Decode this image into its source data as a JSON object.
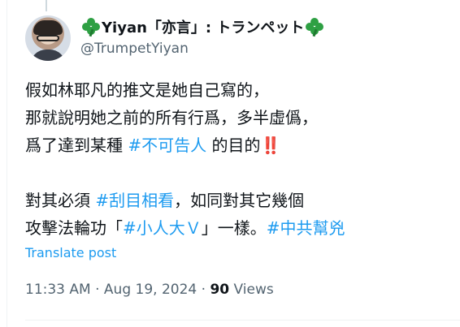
{
  "author": {
    "name_prefix_emoji": "clover-icon",
    "name": "Yiyan「亦言」: トランペット",
    "name_suffix_emoji": "clover-icon",
    "handle": "@TrumpetYiyan"
  },
  "tweet": {
    "lines": [
      [
        {
          "text": "假如林耶凡的推文是她自己寫的，",
          "type": "text"
        }
      ],
      [
        {
          "text": "那就說明她之前的所有行爲，多半虛僞，",
          "type": "text"
        }
      ],
      [
        {
          "text": "爲了達到某種 ",
          "type": "text"
        },
        {
          "text": "#不可告人",
          "type": "hashtag"
        },
        {
          "text": " 的目的",
          "type": "text"
        },
        {
          "text": "‼️",
          "type": "emoji"
        }
      ],
      [
        {
          "text": "",
          "type": "text"
        }
      ],
      [
        {
          "text": "對其必須 ",
          "type": "text"
        },
        {
          "text": "#刮目相看",
          "type": "hashtag"
        },
        {
          "text": "，如同對其它幾個",
          "type": "text"
        }
      ],
      [
        {
          "text": "攻擊法輪功「",
          "type": "text"
        },
        {
          "text": "#小人大Ｖ",
          "type": "hashtag"
        },
        {
          "text": "」一樣。",
          "type": "text"
        },
        {
          "text": "#中共幫兇",
          "type": "hashtag"
        }
      ]
    ],
    "translate_label": "Translate post",
    "time": "11:33 AM",
    "separator": "·",
    "date": "Aug 19, 2024",
    "views_count": "90",
    "views_label": "Views"
  }
}
